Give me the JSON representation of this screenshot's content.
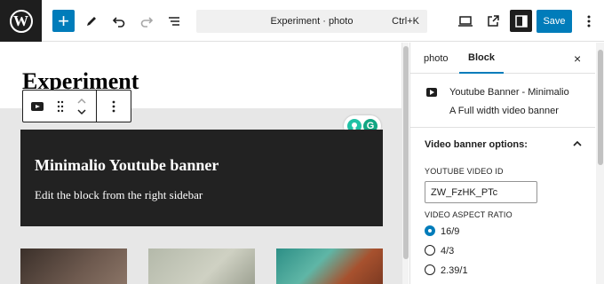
{
  "topbar": {
    "logo": "W",
    "add_icon": "+",
    "document_title": "Experiment · photo",
    "shortcut": "Ctrl+K",
    "save_label": "Save"
  },
  "canvas": {
    "post_title": "Experiment",
    "banner_title": "Minimalio Youtube banner",
    "banner_text": "Edit the block from the right sidebar",
    "grammarly_icon": "G"
  },
  "sidebar": {
    "tab_photo": "photo",
    "tab_block": "Block",
    "close_icon": "×",
    "block_name": "Youtube Banner - Minimalio",
    "block_description": "A Full width video banner",
    "panel_title": "Video banner options:",
    "video_id_label": "YOUTUBE VIDEO ID",
    "video_id_value": "ZW_FzHK_PTc",
    "aspect_ratio_label": "VIDEO ASPECT RATIO",
    "aspect_options": [
      "16/9",
      "4/3",
      "2.39/1"
    ],
    "selected_aspect": "16/9"
  },
  "colors": {
    "accent": "#007cba",
    "dark": "#1e1e1e",
    "banner_bg": "#222222"
  }
}
